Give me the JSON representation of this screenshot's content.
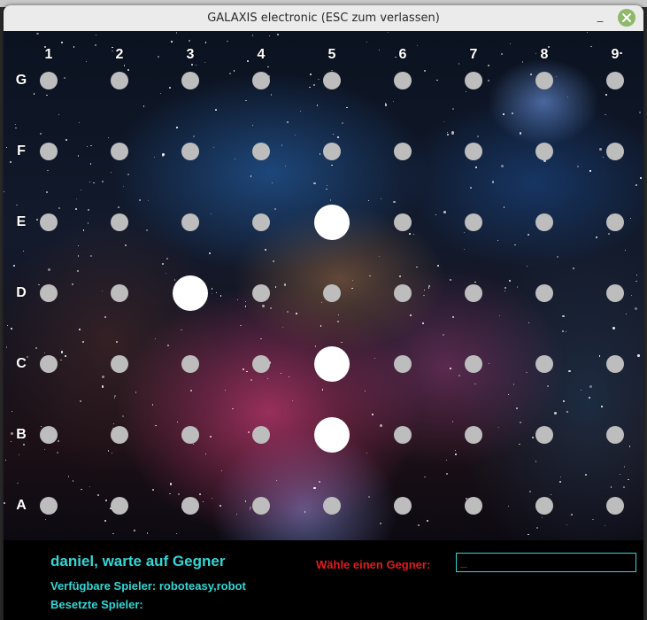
{
  "window": {
    "title": "GALAXIS electronic  (ESC zum verlassen)",
    "minimize_glyph": "_",
    "close_icon": "close-icon",
    "close_color": "#8fb86a"
  },
  "board": {
    "columns": [
      "1",
      "2",
      "3",
      "4",
      "5",
      "6",
      "7",
      "8",
      "9"
    ],
    "rows": [
      "G",
      "F",
      "E",
      "D",
      "C",
      "B",
      "A"
    ],
    "hole_color": "#bdbdbd",
    "ship_color": "#ffffff",
    "ships": [
      {
        "row": "E",
        "col": "5"
      },
      {
        "row": "D",
        "col": "3"
      },
      {
        "row": "C",
        "col": "5"
      },
      {
        "row": "B",
        "col": "5"
      }
    ]
  },
  "status": {
    "message": "daniel, warte auf Gegner",
    "available_players": "Verfügbare Spieler: roboteasy,robot",
    "busy_players": "Besetzte Spieler:",
    "text_color": "#33d6d6"
  },
  "opponent": {
    "label": "Wähle einen Gegner:",
    "value": "_",
    "label_color": "#e01c1c"
  }
}
